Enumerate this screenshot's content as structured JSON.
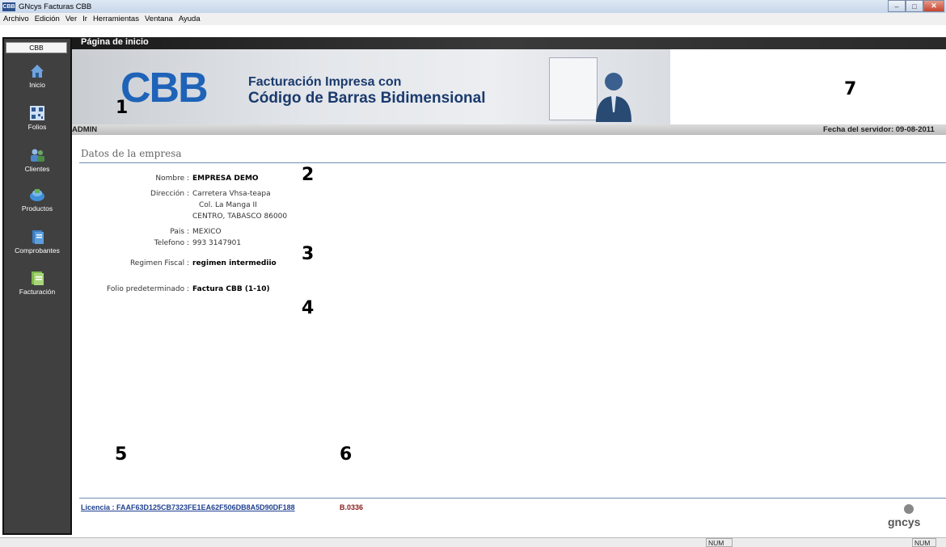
{
  "window": {
    "title": "GNcys Facturas CBB",
    "icon_label": "CBB",
    "minimize": "–",
    "maximize": "□",
    "close": "✕"
  },
  "menu": [
    "Archivo",
    "Edición",
    "Ver",
    "Ir",
    "Herramientas",
    "Ventana",
    "Ayuda"
  ],
  "sidebar": {
    "header": "CBB",
    "items": [
      {
        "label": "Inicio",
        "icon": "home-icon",
        "color": "#5b8fd0"
      },
      {
        "label": "Folios",
        "icon": "qr-code-icon",
        "color": "#4a79b8"
      },
      {
        "label": "Clientes",
        "icon": "clients-icon",
        "color": "#6aa0d8"
      },
      {
        "label": "Productos",
        "icon": "products-icon",
        "color": "#3f8fd6"
      },
      {
        "label": "Comprobantes",
        "icon": "receipt-icon",
        "color": "#3a7cc4"
      },
      {
        "label": "Facturación",
        "icon": "invoice-icon",
        "color": "#7cba4a"
      }
    ]
  },
  "page": {
    "tab_title": "Página de inicio"
  },
  "banner": {
    "logo": "CBB",
    "line1": "Facturación Impresa con",
    "line2": "Código de Barras Bidimensional"
  },
  "info": {
    "user": "ADMIN",
    "server_date": "Fecha del servidor: 09-08-2011"
  },
  "company": {
    "section_title": "Datos de la empresa",
    "nombre_label": "Nombre :",
    "nombre": "EMPRESA DEMO",
    "direccion_label": "Dirección :",
    "direccion1": "Carretera Vhsa-teapa",
    "direccion2": "Col. La Manga II",
    "direccion3": "CENTRO, TABASCO 86000",
    "pais_label": "Pais :",
    "pais": "MEXICO",
    "telefono_label": "Telefono :",
    "telefono": "993 3147901",
    "regimen_label": "Regimen Fiscal :",
    "regimen": "regimen intermediio",
    "folio_label": "Folio predeterminado :",
    "folio": "Factura CBB (1-10)"
  },
  "annotations": [
    "1",
    "2",
    "3",
    "4",
    "5",
    "6",
    "7"
  ],
  "footer": {
    "license": "Licencia : FAAF63D125CB7323FE1EA62F506DB8A5D90DF188",
    "version": "B.0336",
    "brand": "gncys"
  },
  "status": {
    "num1": "NUM",
    "num2": "NUM"
  },
  "colors": {
    "sidebar_bg": "#404040",
    "accent_blue": "#1f63b8",
    "version_red": "#8b1a1a"
  }
}
